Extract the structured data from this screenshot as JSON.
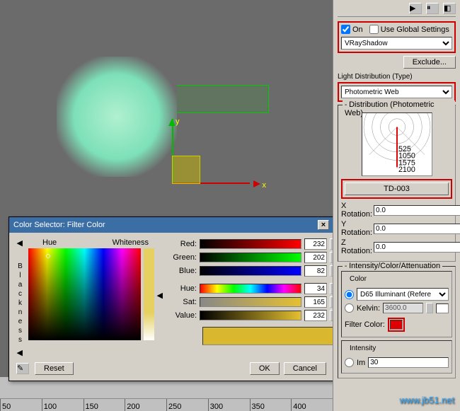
{
  "viewport": {
    "axis_x": "x",
    "axis_y": "y"
  },
  "colorSelector": {
    "title": "Color Selector: Filter Color",
    "hueLabel": "Hue",
    "whitenessLabel": "Whiteness",
    "blacknessLabel": "Blackness",
    "fields": {
      "red": "Red:",
      "green": "Green:",
      "blue": "Blue:",
      "hue": "Hue:",
      "sat": "Sat:",
      "value": "Value:"
    },
    "values": {
      "red": "232",
      "green": "202",
      "blue": "82",
      "hue": "34",
      "sat": "165",
      "value": "232"
    },
    "buttons": {
      "reset": "Reset",
      "ok": "OK",
      "cancel": "Cancel"
    }
  },
  "ruler": [
    "50",
    "100",
    "150",
    "200",
    "250",
    "300",
    "350",
    "400"
  ],
  "panel": {
    "shadows": {
      "on": "On",
      "useGlobal": "Use Global Settings",
      "shadowType": "VRayShadow",
      "exclude": "Exclude..."
    },
    "dist": {
      "label": "Light Distribution (Type)",
      "value": "Photometric Web"
    },
    "web": {
      "header": "Distribution (Photometric Web)",
      "file": "TD-003",
      "ticks": [
        "525",
        "1050",
        "1575",
        "2100"
      ],
      "xrot": "X Rotation:",
      "yrot": "Y Rotation:",
      "zrot": "Z Rotation:",
      "xval": "0.0",
      "yval": "0.0",
      "zval": "0.0"
    },
    "ica": {
      "header": "Intensity/Color/Attenuation",
      "color": "Color",
      "d65": "D65 Illuminant (Refere",
      "kelvin": "Kelvin:",
      "kelvinVal": "3600.0",
      "filter": "Filter Color:",
      "intensity": "Intensity",
      "im": "Im",
      "imval": "30"
    }
  },
  "watermark": "www.jb51.net"
}
